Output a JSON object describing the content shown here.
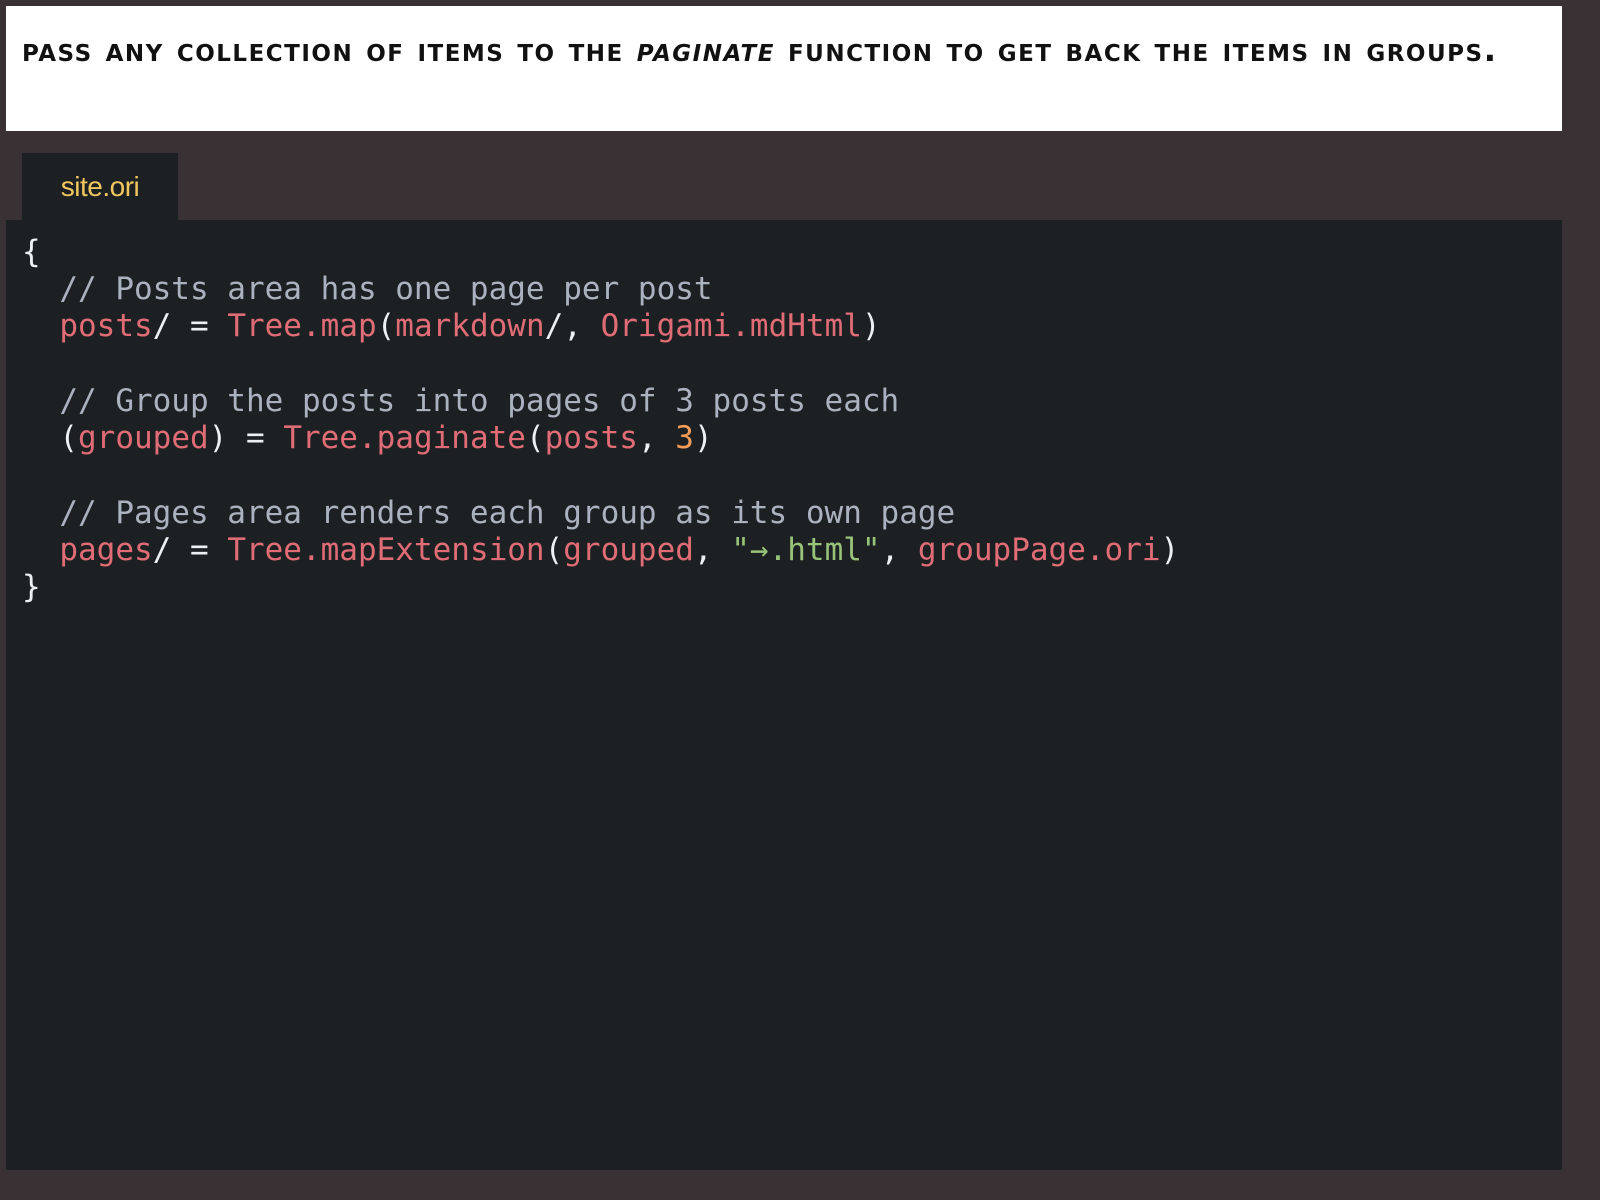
{
  "caption": {
    "before": "Pass any collection of items to the ",
    "emphasis": "paginate",
    "after": " function to get back the items in groups."
  },
  "editor": {
    "tab_label": "site.ori",
    "code": {
      "open_brace": "{",
      "close_brace": "}",
      "comment_posts": "// Posts area has one page per post",
      "posts_name": "posts",
      "posts_slash_eq": "/ = ",
      "tree_map": "Tree.map",
      "paren_open": "(",
      "markdown": "markdown",
      "slash_comma": "/, ",
      "origami_mdhtml": "Origami.mdHtml",
      "paren_close": ")",
      "comment_group": "// Group the posts into pages of 3 posts each",
      "grouped": "grouped",
      "paren_close_eq": ") = ",
      "tree_paginate": "Tree.paginate",
      "posts_arg": "posts",
      "comma": ", ",
      "page_size": "3",
      "comment_pages": "// Pages area renders each group as its own page",
      "pages_name": "pages",
      "tree_map_extension": "Tree.mapExtension",
      "grouped_arg": "grouped",
      "extension_string": "\"→.html\"",
      "group_page": "groupPage.ori"
    }
  }
}
